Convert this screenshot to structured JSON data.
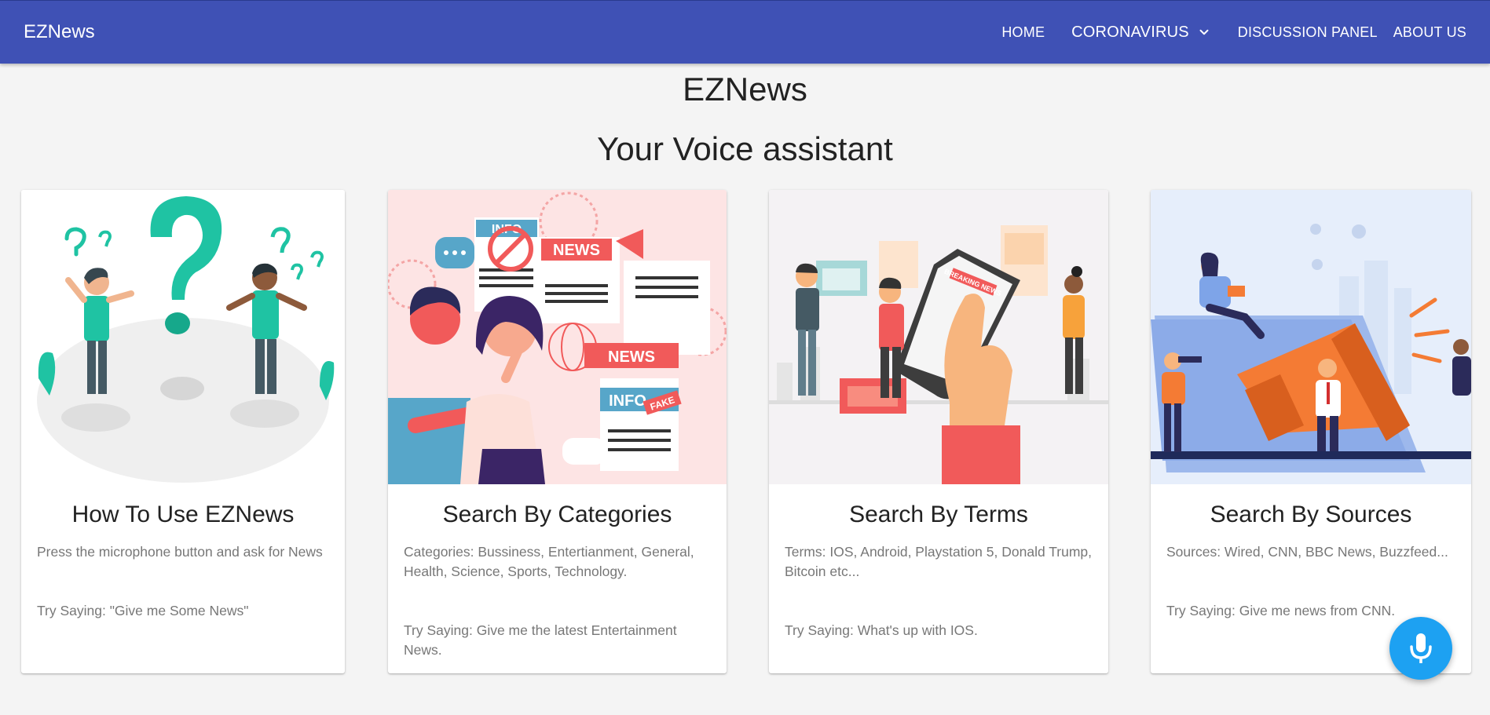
{
  "app": {
    "brand": "EZNews"
  },
  "nav": {
    "home": "HOME",
    "coronavirus": "CORONAVIRUS",
    "discussion": "DISCUSSION PANEL",
    "about": "ABOUT US"
  },
  "hero": {
    "title": "EZNews",
    "subtitle": "Your Voice assistant"
  },
  "cards": [
    {
      "title": "How To Use EZNews",
      "info": "Press the microphone button and ask for News",
      "try": "Try Saying: \"Give me Some News\""
    },
    {
      "title": "Search By Categories",
      "info": "Categories: Bussiness, Entertianment, General, Health, Science, Sports, Technology.",
      "try": "Try Saying: Give me the latest Entertainment News."
    },
    {
      "title": "Search By Terms",
      "info": "Terms: IOS, Android, Playstation 5, Donald Trump, Bitcoin etc...",
      "try": "Try Saying: What's up with IOS."
    },
    {
      "title": "Search By Sources",
      "info": "Sources: Wired, CNN, BBC News, Buzzfeed...",
      "try": "Try Saying: Give me news from CNN."
    }
  ],
  "illustration_text": {
    "info": "INFO",
    "news": "NEWS",
    "fake": "FAKE",
    "breaking": "BREAKING NEWS"
  },
  "colors": {
    "appbar": "#3f51b5",
    "mic_button": "#1da1f2",
    "background": "#f4f4f4"
  },
  "icons": {
    "mic": "microphone-icon",
    "dropdown": "chevron-down-icon"
  }
}
